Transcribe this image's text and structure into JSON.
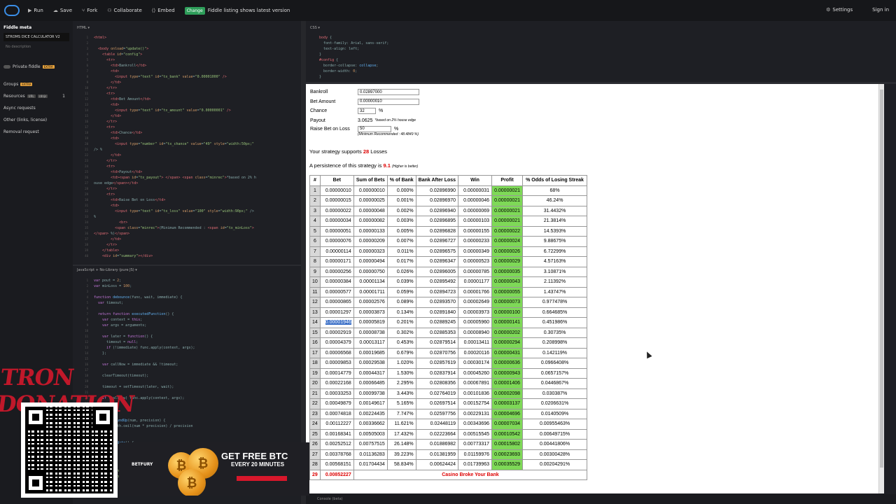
{
  "topbar": {
    "run": "Run",
    "save": "Save",
    "fork": "Fork",
    "collaborate": "Collaborate",
    "embed": "Embed",
    "change_badge": "Change",
    "listing_text": "Fiddle listing shows latest version",
    "settings": "Settings",
    "signin": "Sign in"
  },
  "sidebar": {
    "meta_title": "Fiddle meta",
    "fiddle_name": "STROMS DICE CALCULATOR V2",
    "description_placeholder": "No description",
    "private_fiddle": "Private fiddle",
    "private_tag": "EXTRA",
    "groups": "Groups",
    "groups_tag": "EXTRA",
    "resources": "Resources",
    "resources_tag1": "URL",
    "resources_tag2": "cdnjs",
    "resources_count": "1",
    "async": "Async requests",
    "other": "Other (links, license)",
    "removal": "Removal request"
  },
  "panels": {
    "html": "HTML ▾",
    "css": "CSS ▾",
    "js": "JavaScript + No-Library (pure JS) ▾",
    "console": "Console (beta)"
  },
  "config": {
    "bankroll_label": "Bankroll",
    "bankroll_value": "0.02897000",
    "bet_label": "Bet Amount",
    "bet_value": "0.00000010",
    "chance_label": "Chance",
    "chance_value": "32",
    "chance_unit": "%",
    "payout_label": "Payout",
    "payout_value": "3.0625",
    "payout_note": "*based on 2% house edge",
    "raise_label": "Raise Bet on Loss",
    "raise_value": "50",
    "raise_unit": "%",
    "minrec": "(Minimum Recommended : 48.4849 %)"
  },
  "summary": {
    "supports_pre": "Your strategy supports",
    "supports_num": "28",
    "supports_post": "Losses",
    "persist_pre": "A persistence of this strategy is",
    "persist_num": "9.1",
    "persist_note": "(Higher is better)"
  },
  "table": {
    "headers": [
      "#",
      "Bet",
      "Sum of Bets",
      "% of Bank",
      "Bank After Loss",
      "Win",
      "Profit",
      "% Odds of Losing Streak"
    ],
    "rows": [
      [
        "1",
        "0.00000010",
        "0.00000010",
        "0.000%",
        "0.02896990",
        "0.00000031",
        "0.00000021",
        "68%"
      ],
      [
        "2",
        "0.00000015",
        "0.00000025",
        "0.001%",
        "0.02896970",
        "0.00000046",
        "0.00000021",
        "46.24%"
      ],
      [
        "3",
        "0.00000022",
        "0.00000048",
        "0.002%",
        "0.02896940",
        "0.00000069",
        "0.00000021",
        "31.4432%"
      ],
      [
        "4",
        "0.00000034",
        "0.00000082",
        "0.003%",
        "0.02896895",
        "0.00000103",
        "0.00000021",
        "21.3814%"
      ],
      [
        "5",
        "0.00000051",
        "0.00000133",
        "0.005%",
        "0.02896828",
        "0.00000155",
        "0.00000022",
        "14.5393%"
      ],
      [
        "6",
        "0.00000076",
        "0.00000209",
        "0.007%",
        "0.02896727",
        "0.00000233",
        "0.00000024",
        "9.88675%"
      ],
      [
        "7",
        "0.00000114",
        "0.00000323",
        "0.011%",
        "0.02896575",
        "0.00000349",
        "0.00000026",
        "6.72299%"
      ],
      [
        "8",
        "0.00000171",
        "0.00000494",
        "0.017%",
        "0.02896347",
        "0.00000523",
        "0.00000029",
        "4.57163%"
      ],
      [
        "9",
        "0.00000256",
        "0.00000750",
        "0.026%",
        "0.02896005",
        "0.00000785",
        "0.00000035",
        "3.10871%"
      ],
      [
        "10",
        "0.00000384",
        "0.00001134",
        "0.039%",
        "0.02895492",
        "0.00001177",
        "0.00000043",
        "2.11392%"
      ],
      [
        "11",
        "0.00000577",
        "0.00001711",
        "0.059%",
        "0.02894723",
        "0.00001766",
        "0.00000055",
        "1.43747%"
      ],
      [
        "12",
        "0.00000865",
        "0.00002576",
        "0.089%",
        "0.02893570",
        "0.00002649",
        "0.00000073",
        "0.977478%"
      ],
      [
        "13",
        "0.00001297",
        "0.00003873",
        "0.134%",
        "0.02891840",
        "0.00003973",
        "0.00000100",
        "0.664685%"
      ],
      [
        "14",
        "0.00001946",
        "0.00005819",
        "0.201%",
        "0.02889245",
        "0.00005960",
        "0.00000141",
        "0.451986%"
      ],
      [
        "15",
        "0.00002919",
        "0.00008738",
        "0.302%",
        "0.02885353",
        "0.00008940",
        "0.00000202",
        "0.30735%"
      ],
      [
        "16",
        "0.00004379",
        "0.00013117",
        "0.453%",
        "0.02879514",
        "0.00013411",
        "0.00000294",
        "0.208998%"
      ],
      [
        "17",
        "0.00006568",
        "0.00019685",
        "0.679%",
        "0.02870756",
        "0.00020116",
        "0.00000431",
        "0.142119%"
      ],
      [
        "18",
        "0.00009853",
        "0.00029538",
        "1.020%",
        "0.02857619",
        "0.00030174",
        "0.00000636",
        "0.0966408%"
      ],
      [
        "19",
        "0.00014779",
        "0.00044317",
        "1.530%",
        "0.02837914",
        "0.00045260",
        "0.00000943",
        "0.0657157%"
      ],
      [
        "20",
        "0.00022168",
        "0.00066485",
        "2.295%",
        "0.02808356",
        "0.00067891",
        "0.00001406",
        "0.0446867%"
      ],
      [
        "21",
        "0.00033253",
        "0.00099738",
        "3.443%",
        "0.02764019",
        "0.00101836",
        "0.00002098",
        "0.030387%"
      ],
      [
        "22",
        "0.00049879",
        "0.00149617",
        "5.165%",
        "0.02697514",
        "0.00152754",
        "0.00003137",
        "0.0206631%"
      ],
      [
        "23",
        "0.00074818",
        "0.00224435",
        "7.747%",
        "0.02597756",
        "0.00229131",
        "0.00004696",
        "0.0140509%"
      ],
      [
        "24",
        "0.00112227",
        "0.00336662",
        "11.621%",
        "0.02448119",
        "0.00343696",
        "0.00007034",
        "0.00955463%"
      ],
      [
        "25",
        "0.00168341",
        "0.00505003",
        "17.432%",
        "0.02223664",
        "0.00515545",
        "0.00010542",
        "0.00649715%"
      ],
      [
        "26",
        "0.00252512",
        "0.00757515",
        "26.148%",
        "0.01886982",
        "0.00773317",
        "0.00015802",
        "0.00441806%"
      ],
      [
        "27",
        "0.00378768",
        "0.01136283",
        "39.223%",
        "0.01381959",
        "0.01159976",
        "0.00023693",
        "0.00300428%"
      ],
      [
        "28",
        "0.00568151",
        "0.01704434",
        "58.834%",
        "0.00624424",
        "0.01739963",
        "0.00035529",
        "0.00204291%"
      ]
    ],
    "broke_num": "29",
    "broke_bet": "0.00852227",
    "broke_text": "Casino Broke Your Bank"
  },
  "overlay": {
    "tron": "TRON DONATION",
    "ad_title": "GET FREE BTC",
    "ad_sub": "EVERY 20 MINUTES",
    "ad_brand": "BETFURY",
    "coin_symbol": "₿"
  },
  "colors": {
    "profit": "#7ed957",
    "red": "#dd0000",
    "accent": "#2e9e5a"
  }
}
